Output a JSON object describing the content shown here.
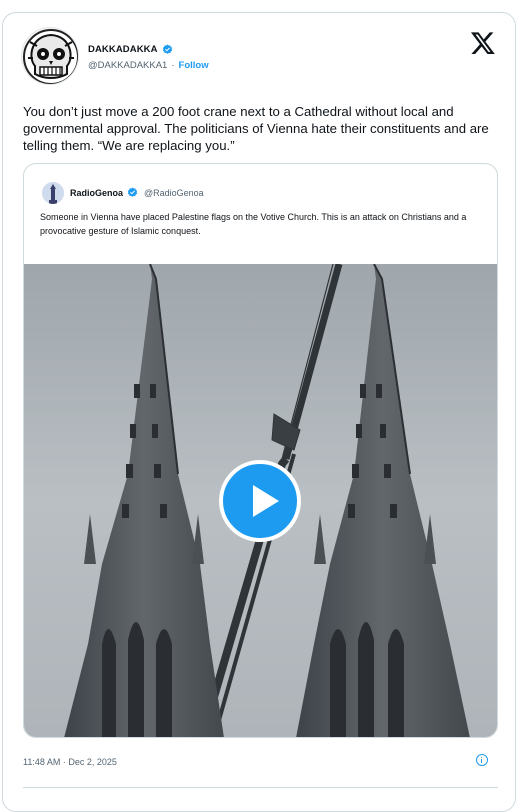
{
  "author": {
    "display_name": "DAKKADAKKA",
    "handle": "@DAKKADAKKA1",
    "separator": "·",
    "follow_label": "Follow"
  },
  "tweet": {
    "text": "You don’t just move a 200 foot crane next to a Cathedral without local and governmental approval. The politicians of Vienna hate their constituents and are telling them. “We are replacing you.”",
    "timestamp": "11:48 AM · Dec 2, 2025"
  },
  "quote": {
    "display_name": "RadioGenoa",
    "handle": "@RadioGenoa",
    "text": "Someone in Vienna have placed Palestine flags on the Votive Church. This is an attack on Christians and a provocative gesture of Islamic conquest."
  },
  "icons": {
    "brand": "x-logo-icon",
    "verified": "verified-badge-icon",
    "play": "play-icon",
    "info": "info-icon"
  },
  "colors": {
    "accent": "#1d9bf0",
    "text": "#0f1419",
    "muted": "#536471",
    "border": "#cfd9de"
  }
}
